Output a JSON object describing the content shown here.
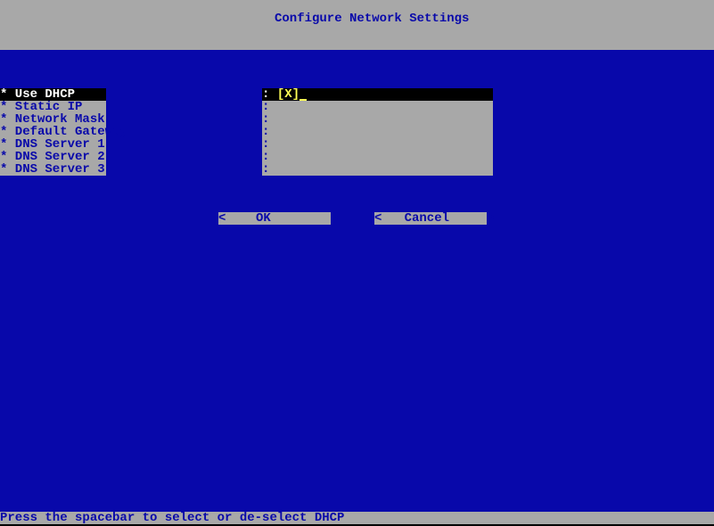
{
  "header": {
    "title": "Configure Network Settings"
  },
  "fields": [
    {
      "label": "* Use DHCP",
      "value": "[X]",
      "selected": true,
      "is_checkbox": true
    },
    {
      "label": "* Static IP",
      "value": "",
      "selected": false,
      "is_checkbox": false
    },
    {
      "label": "* Network Mask",
      "value": "",
      "selected": false,
      "is_checkbox": false
    },
    {
      "label": "* Default Gateway",
      "value": "",
      "selected": false,
      "is_checkbox": false
    },
    {
      "label": "* DNS Server 1",
      "value": "",
      "selected": false,
      "is_checkbox": false
    },
    {
      "label": "* DNS Server 2",
      "value": "",
      "selected": false,
      "is_checkbox": false
    },
    {
      "label": "* DNS Server 3",
      "value": "",
      "selected": false,
      "is_checkbox": false
    }
  ],
  "buttons": {
    "ok": "<    OK        >",
    "cancel": "<   Cancel     >"
  },
  "status": "Press the spacebar to select or de-select DHCP"
}
